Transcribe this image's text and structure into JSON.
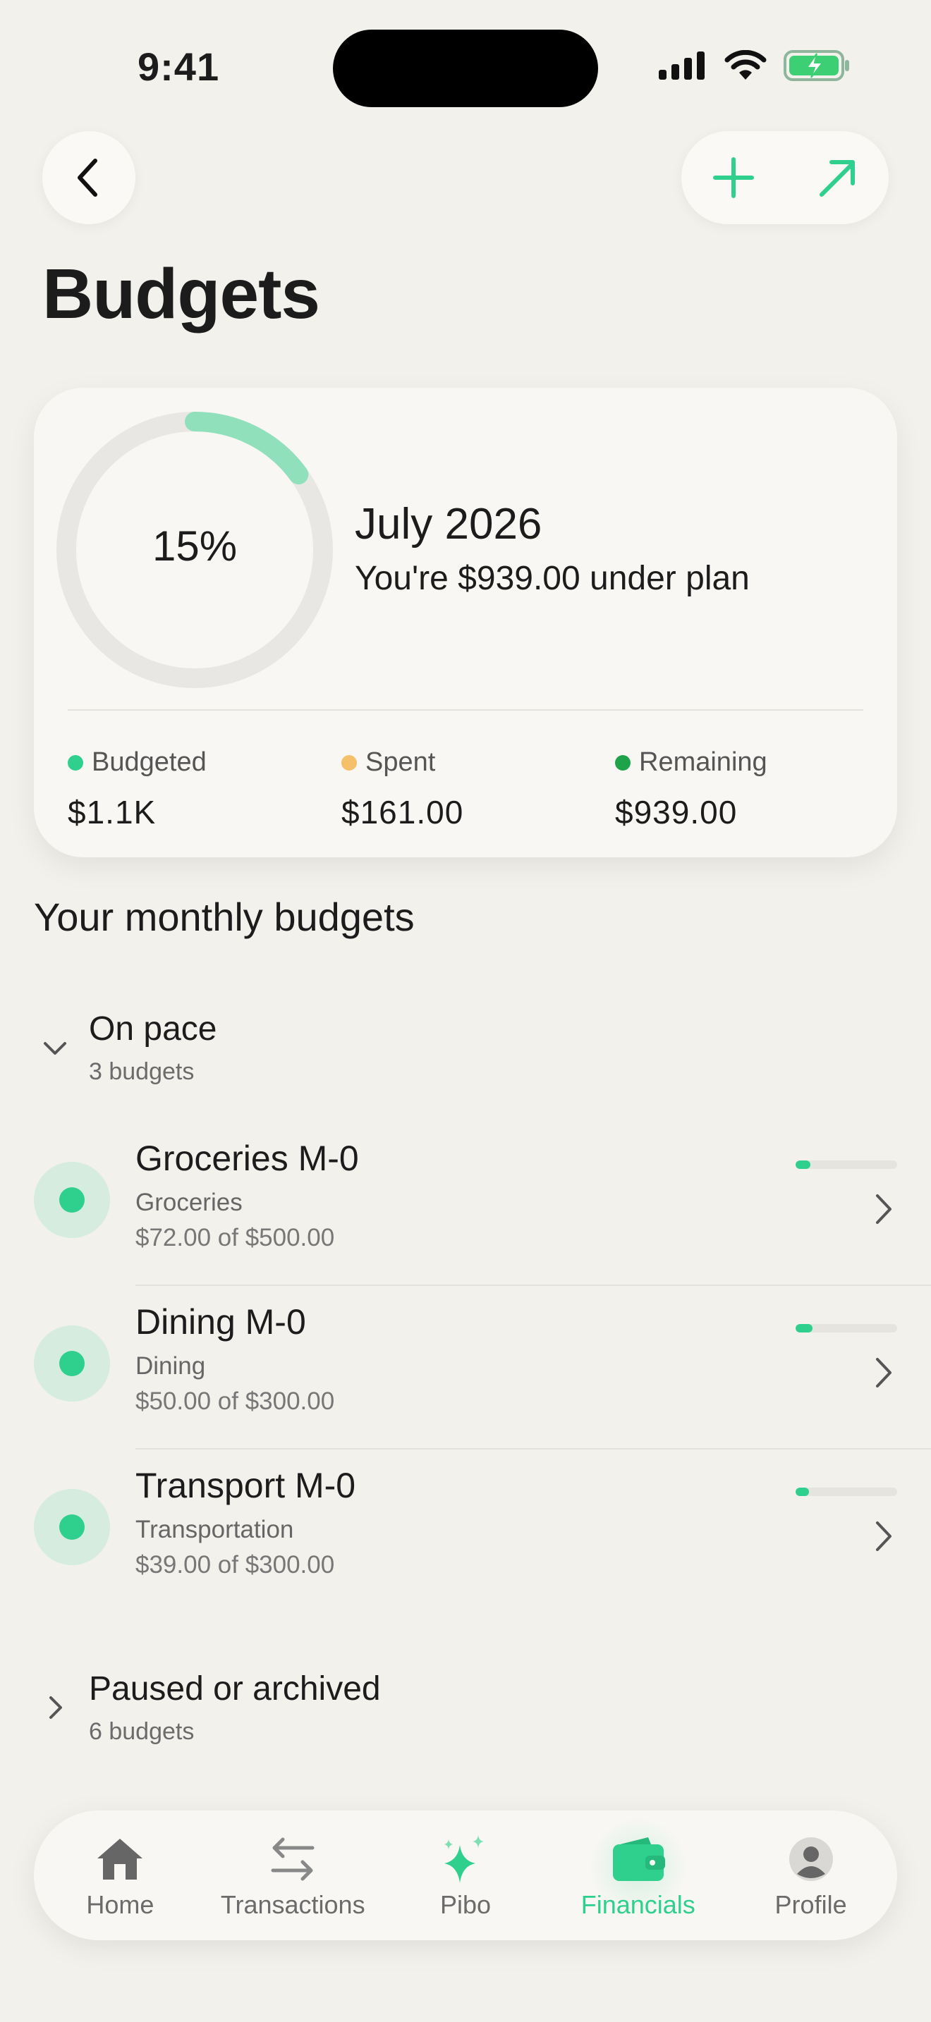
{
  "status_bar": {
    "time": "9:41"
  },
  "page": {
    "title": "Budgets"
  },
  "summary": {
    "percent_label": "15%",
    "progress_fraction": 0.15,
    "month": "July 2026",
    "plan_text": "You're $939.00 under plan",
    "stats": [
      {
        "label": "Budgeted",
        "value": "$1.1K",
        "color": "#2fd08e"
      },
      {
        "label": "Spent",
        "value": "$161.00",
        "color": "#f5c06a"
      },
      {
        "label": "Remaining",
        "value": "$939.00",
        "color": "#1fa34a"
      }
    ]
  },
  "section_title": "Your monthly budgets",
  "groups": {
    "on_pace": {
      "title": "On pace",
      "count": "3 budgets"
    },
    "paused": {
      "title": "Paused or archived",
      "count": "6 budgets"
    }
  },
  "budgets": [
    {
      "name": "Groceries M-0",
      "category": "Groceries",
      "amount": "$72.00 of $500.00",
      "progress": 0.144
    },
    {
      "name": "Dining M-0",
      "category": "Dining",
      "amount": "$50.00 of $300.00",
      "progress": 0.167
    },
    {
      "name": "Transport M-0",
      "category": "Transportation",
      "amount": "$39.00 of $300.00",
      "progress": 0.13
    }
  ],
  "tabs": [
    {
      "label": "Home",
      "icon": "home-icon"
    },
    {
      "label": "Transactions",
      "icon": "transfer-arrows-icon"
    },
    {
      "label": "Pibo",
      "icon": "sparkle-icon"
    },
    {
      "label": "Financials",
      "icon": "wallet-icon",
      "active": true
    },
    {
      "label": "Profile",
      "icon": "profile-icon"
    }
  ],
  "colors": {
    "accent": "#2fd08e",
    "background": "#f3f1ec",
    "card": "#f8f7f3"
  }
}
